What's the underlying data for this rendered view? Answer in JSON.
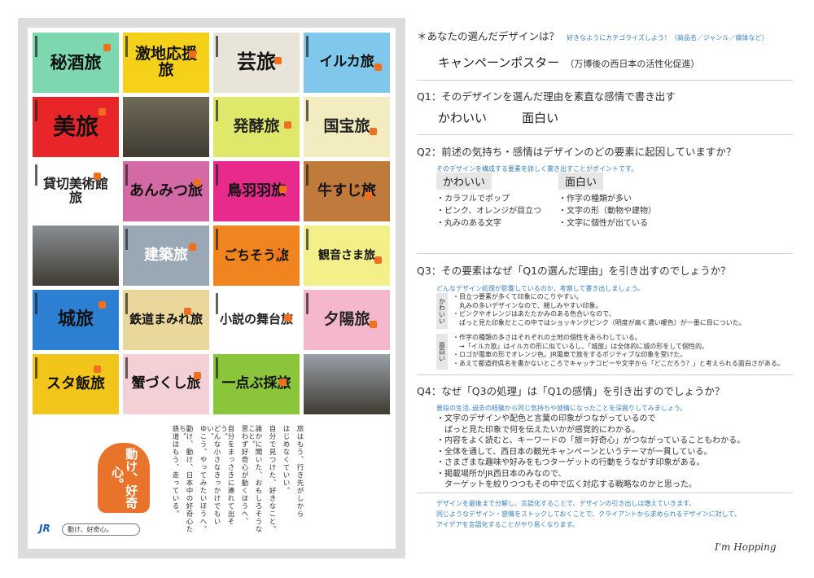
{
  "poster": {
    "tiles": [
      {
        "text": "秘酒旅",
        "bg": "#7dd8b0",
        "fg": "#111",
        "size": 21
      },
      {
        "text": "激地応援旅",
        "bg": "#f5d11a",
        "fg": "#111",
        "size": 19
      },
      {
        "text": "芸旅",
        "bg": "#e8e4da",
        "fg": "#111",
        "size": 24
      },
      {
        "text": "イルカ旅",
        "bg": "#7fc8ec",
        "fg": "#111",
        "size": 17
      },
      {
        "text": "美旅",
        "bg": "#e8262a",
        "fg": "#111",
        "size": 28
      },
      {
        "text": "",
        "bg": "#6f6a58",
        "fg": "#fff",
        "size": 12,
        "photo": true
      },
      {
        "text": "発酵旅",
        "bg": "#dfe86a",
        "fg": "#222",
        "size": 19
      },
      {
        "text": "国宝旅",
        "bg": "#f2ecc0",
        "fg": "#222",
        "size": 19
      },
      {
        "text": "貸切美術館旅",
        "bg": "#ffffff",
        "fg": "#222",
        "size": 16
      },
      {
        "text": "あんみつ旅",
        "bg": "#d36aa6",
        "fg": "#111",
        "size": 18
      },
      {
        "text": "鳥羽羽旅",
        "bg": "#e82a8c",
        "fg": "#111",
        "size": 18
      },
      {
        "text": "牛すじ旅",
        "bg": "#c07a3c",
        "fg": "#111",
        "size": 18
      },
      {
        "text": "",
        "bg": "#8a8f94",
        "fg": "#fff",
        "size": 12,
        "photo": true
      },
      {
        "text": "建築旅",
        "bg": "#9aa7b4",
        "fg": "#fff",
        "size": 18
      },
      {
        "text": "ごちそう旅",
        "bg": "#f0851f",
        "fg": "#111",
        "size": 16
      },
      {
        "text": "観音さま旅",
        "bg": "#f3f08a",
        "fg": "#111",
        "size": 14
      },
      {
        "text": "城旅",
        "bg": "#2c7fd2",
        "fg": "#111",
        "size": 22
      },
      {
        "text": "鉄道まみれ旅",
        "bg": "#e9d79c",
        "fg": "#111",
        "size": 15
      },
      {
        "text": "小説の舞台旅",
        "bg": "#ffffff",
        "fg": "#222",
        "size": 15
      },
      {
        "text": "夕陽旅",
        "bg": "#f4b7cc",
        "fg": "#222",
        "size": 19
      },
      {
        "text": "スタ飯旅",
        "bg": "#f2c51a",
        "fg": "#111",
        "size": 18
      },
      {
        "text": "蟹づくし旅",
        "bg": "#f3d0d6",
        "fg": "#111",
        "size": 17
      },
      {
        "text": "一点ぶ採旅",
        "bg": "#8bc63a",
        "fg": "#111",
        "size": 17
      },
      {
        "text": "",
        "bg": "#9aa0a8",
        "fg": "#fff",
        "size": 12,
        "photo": true
      }
    ],
    "badge": "動け、好奇心。",
    "jr_logo": "JR",
    "slogan": "動け、好奇心。",
    "poem": [
      "旅はもう、行き先がしから",
      "はじめなくていい。",
      "自分で見つけた、好きなこと。",
      "誰かに聞いた、おもしろそうなこと。",
      "思わず好奇心が動くほうへ、",
      "自分をまっさきに連れて出そう。",
      "どんな小さなきっかけでもいい。",
      "ゆこう、やってみたいほうへ。",
      "動け、動け、日本中の好奇心たち。",
      "鉄道はもう、走っている。"
    ]
  },
  "sheet": {
    "header_q": "＊あなたの選んだデザインは？",
    "header_hint": "好きなようにカテゴライズしよう！（商品名／ジャンル／媒体など）",
    "design_name": "キャンペーンポスター",
    "design_note": "（万博後の西日本の活性化促進）",
    "q1": "Q1：そのデザインを選んだ理由を素直な感情で書き出す",
    "q1_answers": [
      "かわいい",
      "面白い"
    ],
    "q2": "Q2：前述の気持ち・感情はデザインのどの要素に起因していますか？",
    "q2_hint": "そのデザインを構成する要素を詳しく書き出すことがポイントです。",
    "q2_cols": [
      {
        "label": "かわいい",
        "items": [
          "・カラフルでポップ",
          "・ピンク、オレンジが目立つ",
          "・丸みのある文字"
        ]
      },
      {
        "label": "面白い",
        "items": [
          "・作字の種類が多い",
          "・文字の形（動物や建物）",
          "・文字に個性が出ている"
        ]
      }
    ],
    "q3": "Q3：その要素はなぜ「Q1の選んだ理由」を引き出すのでしょうか？",
    "q3_hint": "どんなデザイン処理が影響しているのか、考察して書き出しましょう。",
    "q3_blocks": [
      {
        "label": "かわいい",
        "lines": [
          "・目立つ要素が多くて印象にのこりやすい。",
          "　丸みの多いデザインなので、親しみやすい印象。",
          "・ピンクやオレンジはあたたかみのある色合いなので、",
          "　ぱっと見た印象だとこの中ではショッキングピンク（明度が高く濃い暖色）が一番に目についた。"
        ]
      },
      {
        "label": "面白い",
        "lines": [
          "・作字の種類の多さはそれぞれの土地の個性をあらわしている。",
          "　→「イルカ旅」はイルカの形に似ているし、「城旅」は全体的に城の形をして個性的。",
          "・ロゴが電車の形でオレンジ色。JR電車で旅をするポジティブな印象を受けた。",
          "・あえて都道府県名を書かないところでキャッチコピーや文字から「どこだろう？」と考えられる面白さがある。"
        ]
      }
    ],
    "q4": "Q4：なぜ「Q3の処理」は「Q1の感情」を引き出すのでしょうか？",
    "q4_hint": "普段の生活､過去の経験から同じ気持ちや感情になったことを深掘りしてみましょう。",
    "q4_lines": [
      "・文字のデザインや配色と言葉の印象がつながっているので",
      "　ぱっと見た印象で何を伝えたいかが感覚的にわかる。",
      "・内容をよく読むと、キーワードの「旅＝好奇心」がつながっていることもわかる。",
      "・全体を通して、西日本の観光キャンペーンというテーマが一貫している。",
      "・さまざまな趣味や好みをもつターゲットの行動をうながす印象がある。",
      "・掲載場所がJR西日本のみなので、",
      "　ターゲットを絞りつつもその中で広く対応する戦略なのかと思った。"
    ],
    "footer": [
      "デザインを最後まで分解し、言語化することで、デザインの引き出しは増えていきます。",
      "同じようなデザイン・感情をストックしておくことで、クライアントから求められるデザインに対して、",
      "アイデアを言語化することがやり易くなります。"
    ]
  },
  "signature": "I'm Hopping"
}
